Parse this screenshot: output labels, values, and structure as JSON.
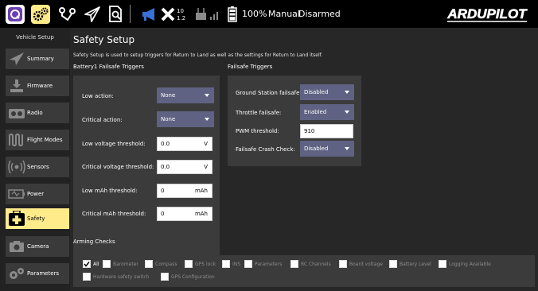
{
  "toolbar": {
    "icons": {
      "home": "qgc-logo-icon",
      "setup": "gears-icon",
      "plan": "waypoint-route-icon",
      "fly": "paper-plane-icon",
      "analyze": "document-magnifier-icon",
      "messages": "megaphone-icon",
      "gps": "satellite-crossed-icon",
      "rc": "rc-transmitter-signal-icon",
      "battery": "battery-icon"
    },
    "gps_count": "10",
    "gps_hdop": "1.2",
    "battery_percent": "100%",
    "flight_mode": "Manual",
    "arm_state": "Disarmed",
    "logo_text": "ARDUPILOT",
    "colors": {
      "accent": "#ffeb8a",
      "messages_icon": "#3a6fd8",
      "logo_outline": "#ffffff"
    }
  },
  "sidebar": {
    "title": "Vehicle Setup",
    "items": [
      {
        "label": "Summary",
        "icon": "paper-plane-icon"
      },
      {
        "label": "Firmware",
        "icon": "download-icon"
      },
      {
        "label": "Radio",
        "icon": "radio-icon"
      },
      {
        "label": "Flight Modes",
        "icon": "flight-modes-wave-icon"
      },
      {
        "label": "Sensors",
        "icon": "sensor-waves-icon"
      },
      {
        "label": "Power",
        "icon": "power-battery-icon"
      },
      {
        "label": "Safety",
        "icon": "medical-cross-icon",
        "active": true
      },
      {
        "label": "Camera",
        "icon": "camera-icon"
      },
      {
        "label": "Parameters",
        "icon": "gears-icon"
      }
    ]
  },
  "page": {
    "title": "Safety Setup",
    "description": "Safety Setup is used to setup triggers for Return to Land as well as the settings for Return to Land itself."
  },
  "battery_failsafe": {
    "title": "Battery1 Failsafe Triggers",
    "low_action": {
      "label": "Low action:",
      "value": "None"
    },
    "critical_action": {
      "label": "Critical action:",
      "value": "None"
    },
    "low_voltage": {
      "label": "Low voltage threshold:",
      "value": "0.0",
      "unit": "V"
    },
    "critical_voltage": {
      "label": "Critical voltage threshold:",
      "value": "0.0",
      "unit": "V"
    },
    "low_mah": {
      "label": "Low mAh threshold:",
      "value": "0",
      "unit": "mAh"
    },
    "critical_mah": {
      "label": "Critical mAh threshold:",
      "value": "0",
      "unit": "mAh"
    }
  },
  "failsafe_triggers": {
    "title": "Failsafe Triggers",
    "gcs": {
      "label": "Ground Station failsafe:",
      "value": "Disabled"
    },
    "throttle": {
      "label": "Throttle failsafe:",
      "value": "Enabled"
    },
    "pwm": {
      "label": "PWM threshold:",
      "value": "910"
    },
    "crash": {
      "label": "Failsafe Crash Check:",
      "value": "Disabled"
    }
  },
  "arming": {
    "title": "Arming Checks",
    "checks": [
      {
        "label": "All",
        "checked": true
      },
      {
        "label": "Barometer",
        "checked": false
      },
      {
        "label": "Compass",
        "checked": false
      },
      {
        "label": "GPS lock",
        "checked": false
      },
      {
        "label": "INS",
        "checked": false
      },
      {
        "label": "Parameters",
        "checked": false
      },
      {
        "label": "RC Channels",
        "checked": false
      },
      {
        "label": "Board voltage",
        "checked": false
      },
      {
        "label": "Battery Level",
        "checked": false
      },
      {
        "label": "Logging Available",
        "checked": false
      },
      {
        "label": "Hardware safety switch",
        "checked": false
      },
      {
        "label": "GPS Configuration",
        "checked": false
      }
    ]
  }
}
